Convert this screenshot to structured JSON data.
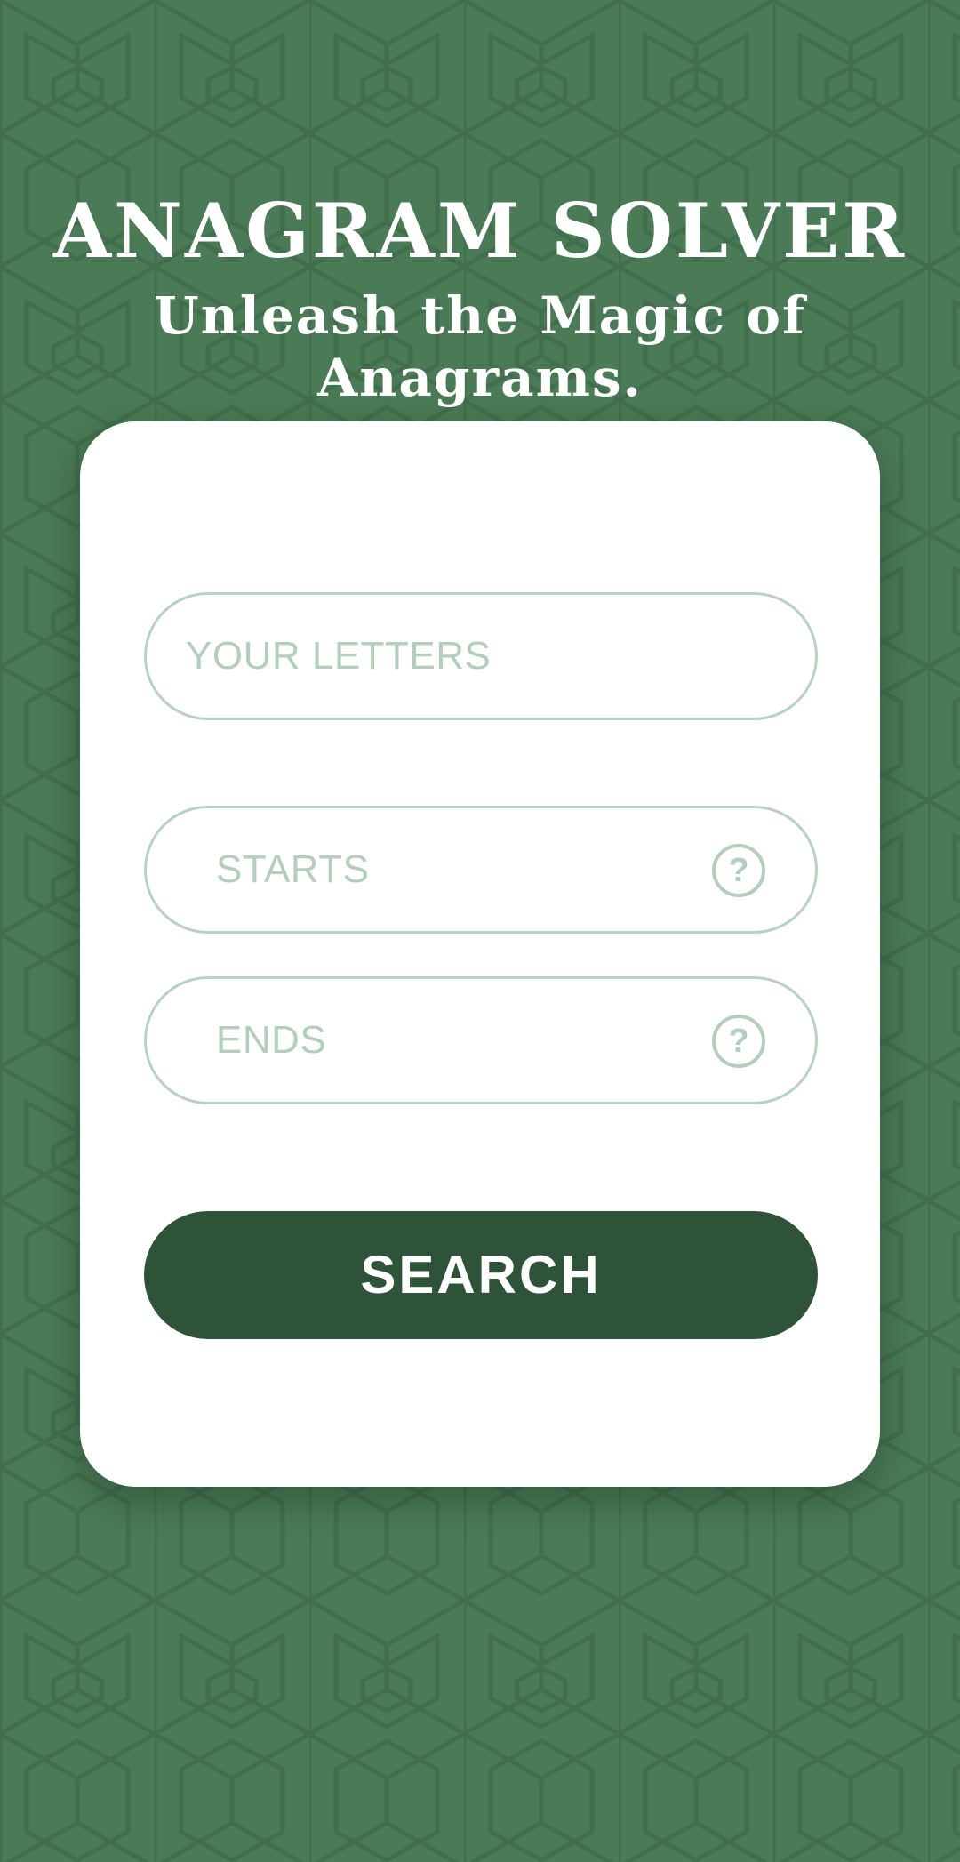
{
  "header": {
    "title": "ANAGRAM SOLVER",
    "subtitle": "Unleash the Magic of Anagrams."
  },
  "form": {
    "letters_placeholder": "YOUR LETTERS",
    "starts_placeholder": "STARTS",
    "ends_placeholder": "ENDS",
    "help_symbol": "?",
    "search_label": "SEARCH"
  },
  "colors": {
    "background": "#4a7a56",
    "card": "#ffffff",
    "field_border": "#b7d3bf",
    "placeholder": "#b3cfbb",
    "button": "#2f5339",
    "button_text": "#ffffff"
  },
  "icons": {
    "help": "question-circle-icon"
  }
}
